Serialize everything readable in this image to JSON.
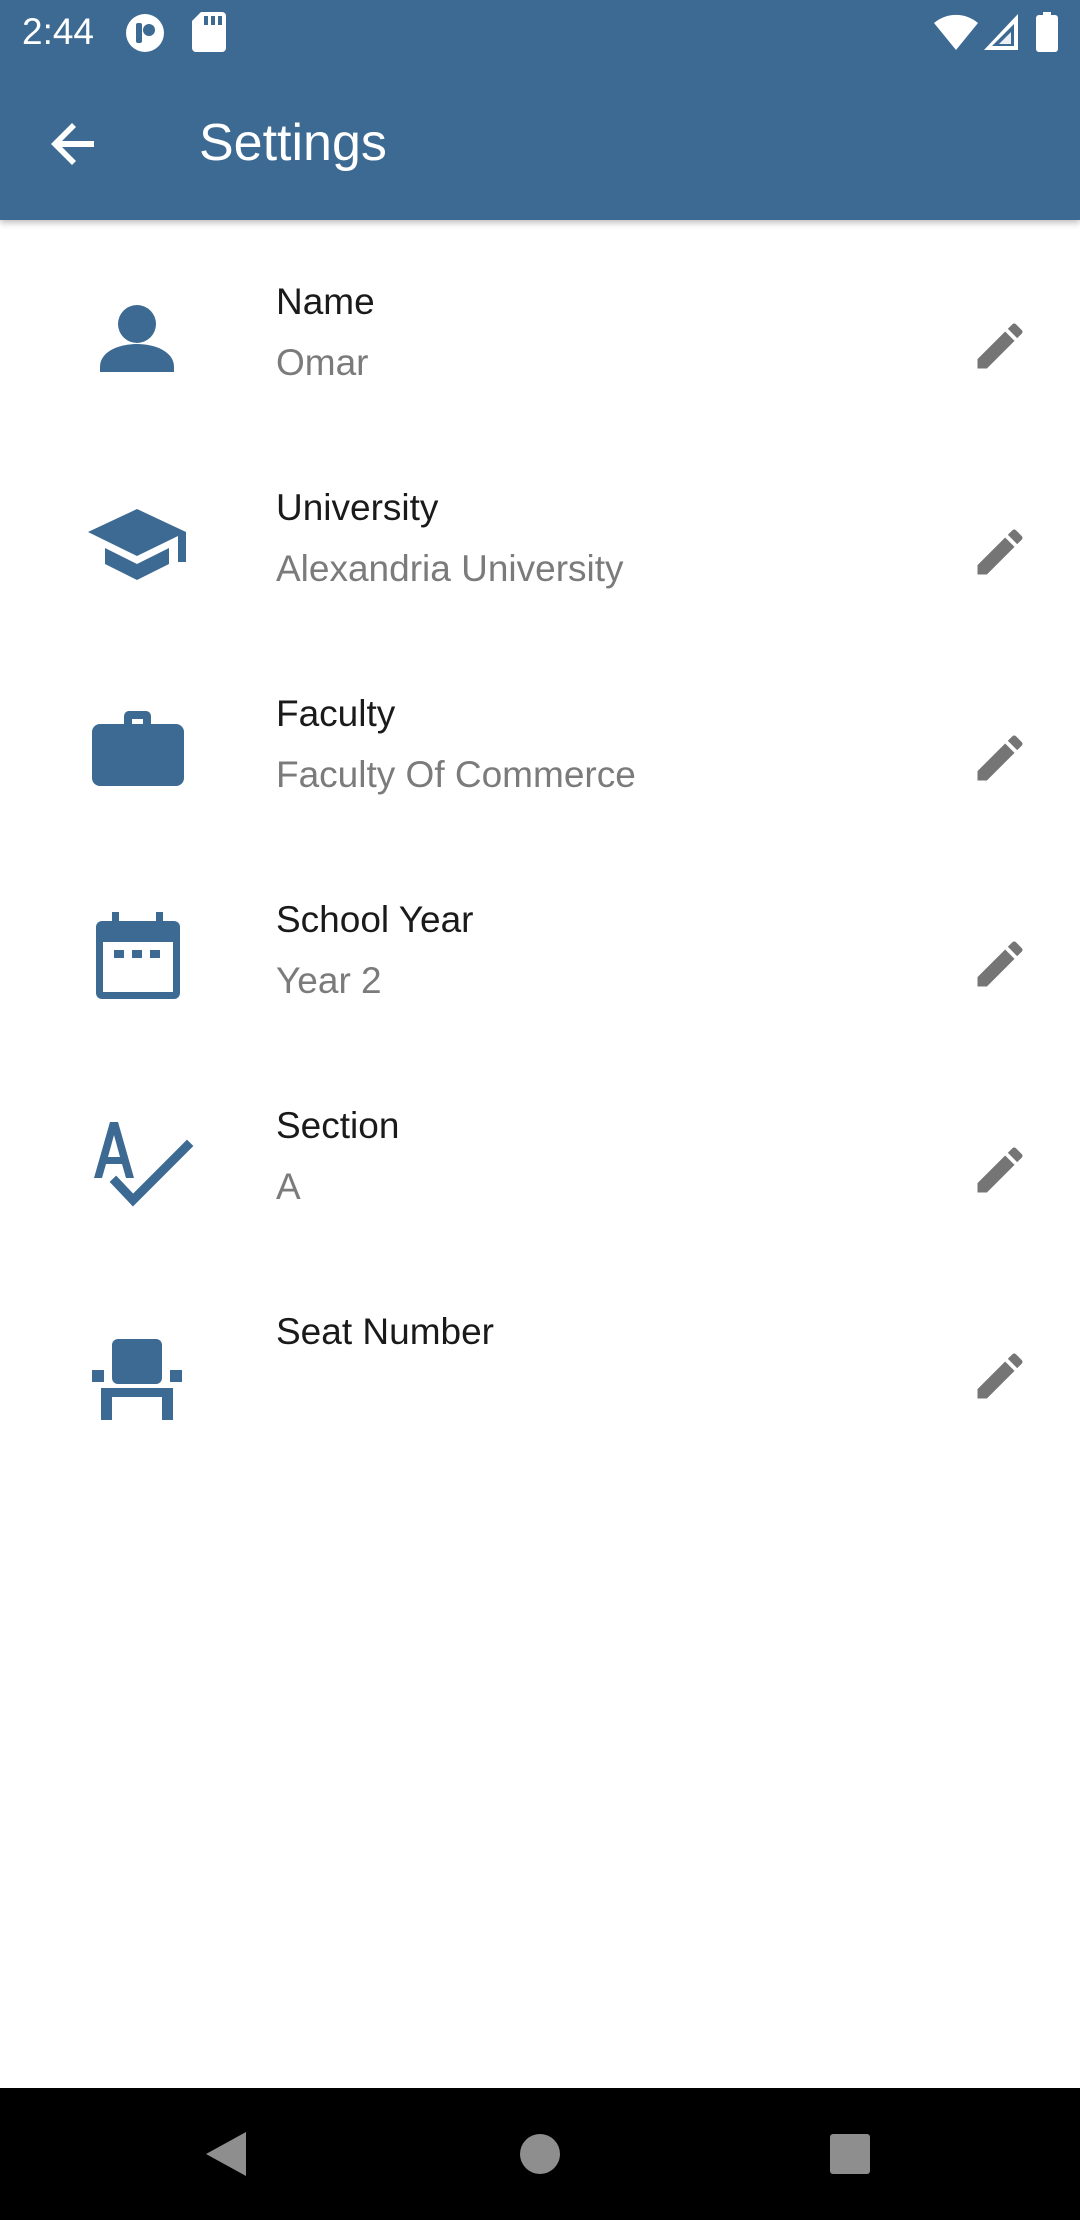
{
  "status_bar": {
    "time": "2:44",
    "icons": [
      "app-notification-icon",
      "sd-card-icon",
      "wifi-icon",
      "signal-icon",
      "battery-icon"
    ]
  },
  "app_bar": {
    "title": "Settings",
    "back_icon": "arrow-back-icon",
    "background_color": "#3c6a92"
  },
  "accent_color": "#3c6a92",
  "settings": [
    {
      "icon": "person-icon",
      "label": "Name",
      "value": "Omar"
    },
    {
      "icon": "graduation-cap-icon",
      "label": "University",
      "value": "Alexandria University"
    },
    {
      "icon": "briefcase-icon",
      "label": "Faculty",
      "value": "Faculty Of Commerce"
    },
    {
      "icon": "calendar-icon",
      "label": "School Year",
      "value": "Year 2"
    },
    {
      "icon": "spellcheck-icon",
      "label": "Section",
      "value": "A"
    },
    {
      "icon": "seat-icon",
      "label": "Seat Number",
      "value": ""
    }
  ],
  "edit_icon": "pencil-icon",
  "nav_bar": {
    "buttons": [
      "back-triangle-icon",
      "home-circle-icon",
      "recents-square-icon"
    ]
  }
}
